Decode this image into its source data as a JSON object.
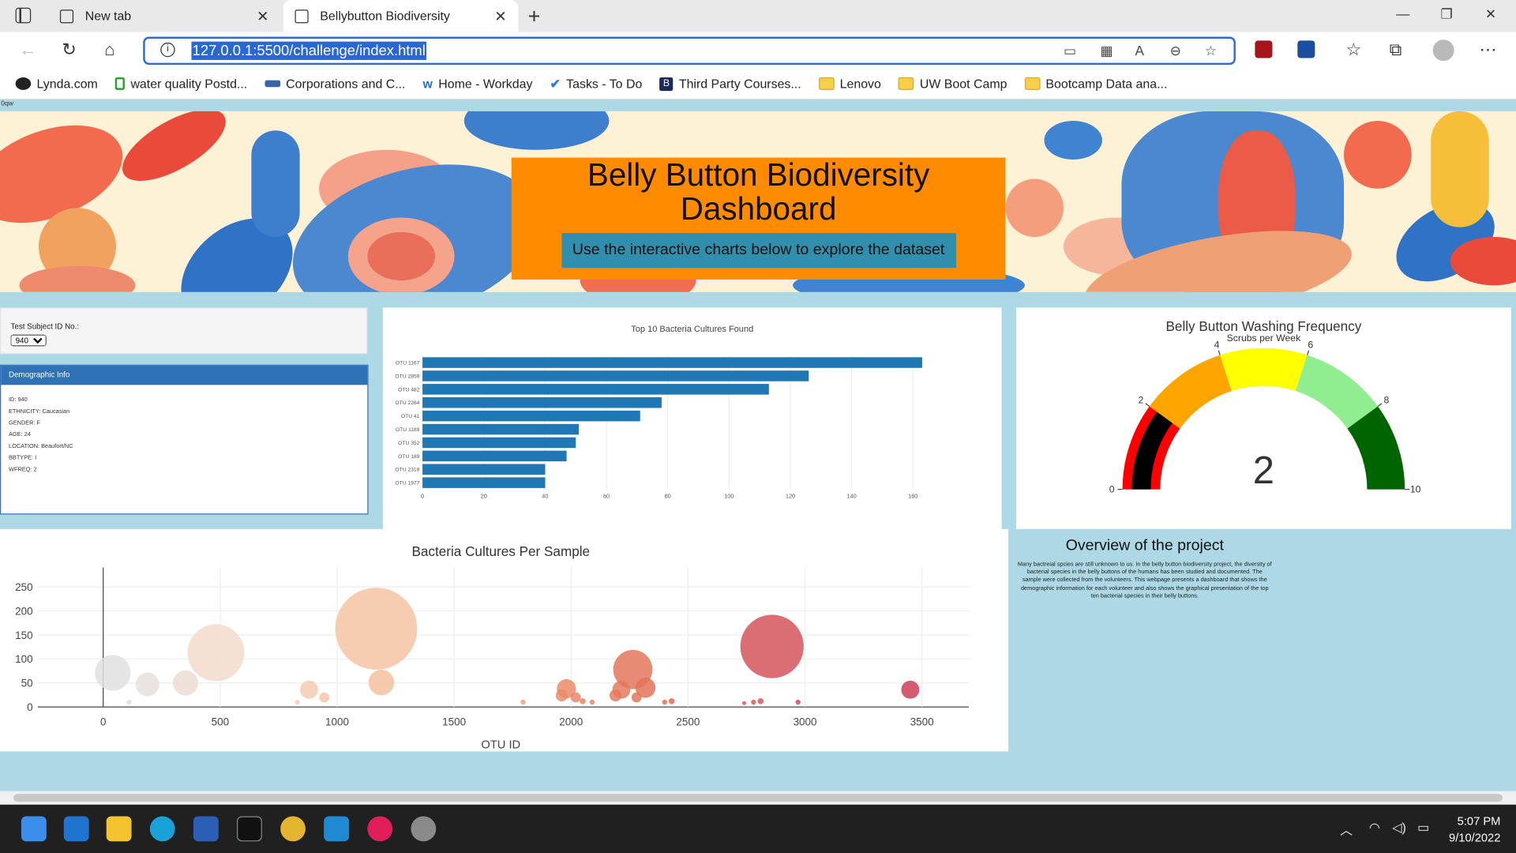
{
  "browser": {
    "tabs": [
      {
        "title": "New tab"
      },
      {
        "title": "Bellybutton Biodiversity"
      }
    ],
    "url": "127.0.0.1:5500/challenge/index.html",
    "bookmarks": [
      {
        "label": "Lynda.com",
        "icon": "lynda-icon"
      },
      {
        "label": "water quality Postd...",
        "icon": "page-icon"
      },
      {
        "label": "Corporations and C...",
        "icon": "site-icon"
      },
      {
        "label": "Home - Workday",
        "icon": "workday-icon"
      },
      {
        "label": "Tasks - To Do",
        "icon": "check-icon"
      },
      {
        "label": "Third Party Courses...",
        "icon": "b-icon"
      },
      {
        "label": "Lenovo",
        "icon": "folder-icon"
      },
      {
        "label": "UW Boot Camp",
        "icon": "folder-icon"
      },
      {
        "label": "Bootcamp Data ana...",
        "icon": "folder-icon"
      }
    ]
  },
  "page": {
    "corner_text": "0qw",
    "title": "Belly Button Biodiversity Dashboard",
    "lead": "Use the interactive charts below to explore the dataset",
    "selector": {
      "label": "Test Subject ID No.:",
      "value": "940"
    },
    "demographic": {
      "header": "Demographic Info",
      "lines": [
        "ID: 940",
        "ETHNICITY: Caucasian",
        "GENDER: F",
        "AGE: 24",
        "LOCATION: Beaufort/NC",
        "BBTYPE: I",
        "WFREQ: 2"
      ]
    },
    "overview": {
      "title": "Overview of the project",
      "text": "Many bactreial spcies are still unknown to us. In the belly button biodiversity project, the diversity of bacterial species in the belly buttons of the humans has been studied and documented. The sample were collected from the volunteers. This webpage presents a dashboard that shows the demographic information for each volunteer and also shows the graphical presentation of the top ten bacterial species in their belly buttons."
    }
  },
  "chart_data": [
    {
      "type": "bar",
      "orientation": "horizontal",
      "title": "Top 10 Bacteria Cultures Found",
      "categories": [
        "OTU 1167",
        "OTU 2859",
        "OTU 482",
        "OTU 2264",
        "OTU 41",
        "OTU 1189",
        "OTU 352",
        "OTU 189",
        "OTU 2318",
        "OTU 1977"
      ],
      "values": [
        163,
        126,
        113,
        78,
        71,
        51,
        50,
        47,
        40,
        40
      ],
      "xlim": [
        0,
        170
      ],
      "xticks": [
        0,
        20,
        40,
        60,
        80,
        100,
        120,
        140,
        160
      ],
      "color": "#1f77b4"
    },
    {
      "type": "gauge",
      "title": "Belly Button Washing Frequency",
      "subtitle": "Scrubs per Week",
      "value": 2,
      "range": [
        0,
        10
      ],
      "ticks": [
        0,
        2,
        4,
        6,
        8,
        10
      ],
      "steps": [
        {
          "range": [
            0,
            2
          ],
          "color": "#ff0000"
        },
        {
          "range": [
            2,
            4
          ],
          "color": "#ffa500"
        },
        {
          "range": [
            4,
            6
          ],
          "color": "#ffff00"
        },
        {
          "range": [
            6,
            8
          ],
          "color": "#90ee90"
        },
        {
          "range": [
            8,
            10
          ],
          "color": "#006400"
        }
      ],
      "bar_color": "#000000"
    },
    {
      "type": "scatter",
      "title": "Bacteria Cultures Per Sample",
      "xlabel": "OTU ID",
      "xticks": [
        0,
        500,
        1000,
        1500,
        2000,
        2500,
        3000,
        3500
      ],
      "yticks": [
        0,
        50,
        100,
        150,
        200,
        250
      ],
      "xlim": [
        -280,
        3700
      ],
      "ylim": [
        0,
        290
      ],
      "points": [
        {
          "x": 41,
          "y": 71,
          "size": 71,
          "color": "#e0e0e0"
        },
        {
          "x": 110,
          "y": 10,
          "size": 10,
          "color": "#e0e0e0"
        },
        {
          "x": 189,
          "y": 47,
          "size": 47,
          "color": "#e6e1de"
        },
        {
          "x": 352,
          "y": 50,
          "size": 50,
          "color": "#eddcd4"
        },
        {
          "x": 482,
          "y": 113,
          "size": 113,
          "color": "#f2dccd"
        },
        {
          "x": 830,
          "y": 10,
          "size": 10,
          "color": "#f4cfb7"
        },
        {
          "x": 880,
          "y": 36,
          "size": 36,
          "color": "#f4cbb1"
        },
        {
          "x": 945,
          "y": 20,
          "size": 20,
          "color": "#f5c7a9"
        },
        {
          "x": 1167,
          "y": 163,
          "size": 163,
          "color": "#f6c4a3"
        },
        {
          "x": 1189,
          "y": 51,
          "size": 51,
          "color": "#f4c19e"
        },
        {
          "x": 1795,
          "y": 10,
          "size": 10,
          "color": "#f0a27f"
        },
        {
          "x": 1960,
          "y": 24,
          "size": 24,
          "color": "#ec8d6d"
        },
        {
          "x": 1980,
          "y": 38,
          "size": 38,
          "color": "#eb8a6a"
        },
        {
          "x": 2020,
          "y": 20,
          "size": 20,
          "color": "#ea8668"
        },
        {
          "x": 2050,
          "y": 12,
          "size": 12,
          "color": "#e98466"
        },
        {
          "x": 2090,
          "y": 10,
          "size": 10,
          "color": "#e88264"
        },
        {
          "x": 2190,
          "y": 24,
          "size": 24,
          "color": "#e67c60"
        },
        {
          "x": 2215,
          "y": 36,
          "size": 36,
          "color": "#e57a5f"
        },
        {
          "x": 2264,
          "y": 78,
          "size": 78,
          "color": "#e4775d"
        },
        {
          "x": 2280,
          "y": 20,
          "size": 20,
          "color": "#e3765c"
        },
        {
          "x": 2318,
          "y": 40,
          "size": 40,
          "color": "#e2745b"
        },
        {
          "x": 2400,
          "y": 10,
          "size": 10,
          "color": "#e06f58"
        },
        {
          "x": 2430,
          "y": 12,
          "size": 12,
          "color": "#df6d57"
        },
        {
          "x": 2740,
          "y": 8,
          "size": 8,
          "color": "#d95d5a"
        },
        {
          "x": 2780,
          "y": 10,
          "size": 10,
          "color": "#d85a5a"
        },
        {
          "x": 2810,
          "y": 12,
          "size": 12,
          "color": "#d7585b"
        },
        {
          "x": 2859,
          "y": 126,
          "size": 126,
          "color": "#d5535c"
        },
        {
          "x": 2970,
          "y": 10,
          "size": 10,
          "color": "#d24e5c"
        },
        {
          "x": 3450,
          "y": 36,
          "size": 36,
          "color": "#cc3f58"
        }
      ]
    }
  ]
}
